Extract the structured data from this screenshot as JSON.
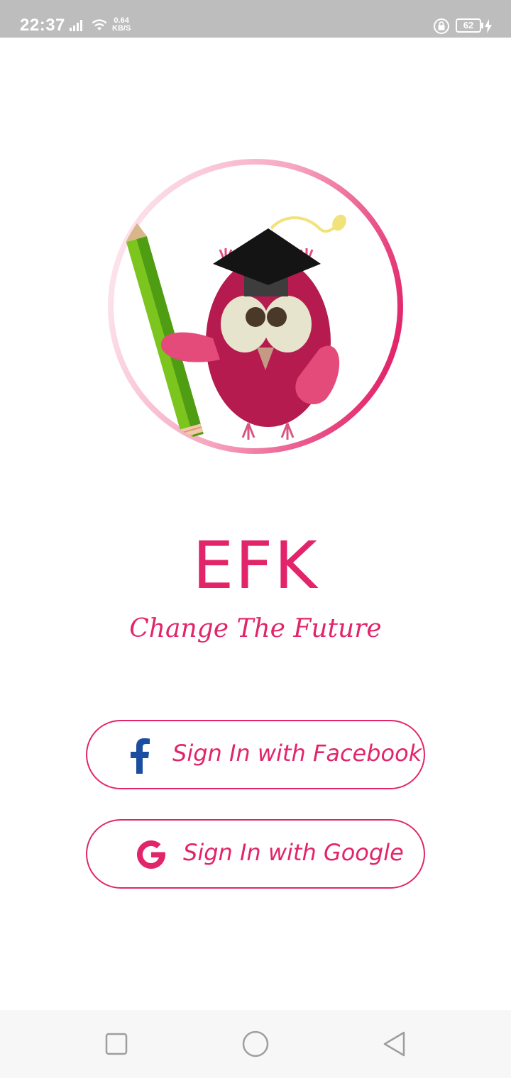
{
  "status_bar": {
    "time": "22:37",
    "net_speed_value": "0.64",
    "net_speed_unit": "KB/S",
    "battery_level": "62",
    "icons": [
      "signal-icon",
      "wifi-icon",
      "rotation-lock-icon",
      "battery-icon",
      "charging-icon"
    ]
  },
  "app": {
    "title": "EFK",
    "tagline": "Change The Future",
    "logo": "owl-graduate-logo"
  },
  "buttons": {
    "facebook_label": "Sign In with Facebook",
    "google_label": "Sign In with Google"
  },
  "nav_bar": {
    "icons": [
      "recents-icon",
      "home-icon",
      "back-icon"
    ]
  },
  "colors": {
    "accent": "#e2256a",
    "facebook": "#1a4fa0",
    "status_bar": "#bdbdbd",
    "nav_bar": "#f7f7f7"
  }
}
